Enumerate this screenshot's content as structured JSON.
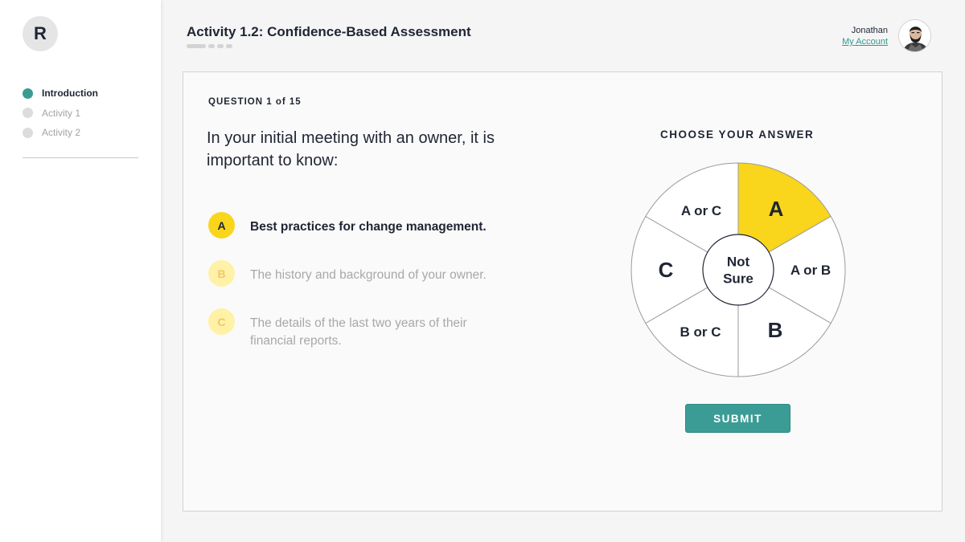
{
  "logo": {
    "letter": "R"
  },
  "sidebar": {
    "items": [
      {
        "label": "Introduction",
        "active": true
      },
      {
        "label": "Activity 1",
        "active": false
      },
      {
        "label": "Activity 2",
        "active": false
      }
    ]
  },
  "header": {
    "title": "Activity 1.2: Confidence-Based Assessment",
    "progress_segments": 4,
    "progress_completed": 0
  },
  "user": {
    "name": "Jonathan",
    "account_link": "My Account"
  },
  "question": {
    "label": "QUESTION 1 of 15",
    "text": "In your initial meeting with an owner, it is important to know:",
    "options": [
      {
        "letter": "A",
        "text": "Best practices for change management.",
        "selected": true
      },
      {
        "letter": "B",
        "text": "The history and background of your owner.",
        "selected": false
      },
      {
        "letter": "C",
        "text": "The details of the last two years of their financial reports.",
        "selected": false
      }
    ]
  },
  "answer_wheel": {
    "title": "CHOOSE YOUR ANSWER",
    "segments": [
      "A",
      "A or B",
      "B",
      "B or C",
      "C",
      "A or C"
    ],
    "selected": "A",
    "center_label": "Not Sure"
  },
  "submit": {
    "label": "SUBMIT"
  },
  "colors": {
    "accent": "#3b9c95",
    "highlight": "#f9d51c",
    "text_dark": "#1f2533",
    "muted": "#a8a8a8",
    "badge_light": "#fff1a6"
  }
}
